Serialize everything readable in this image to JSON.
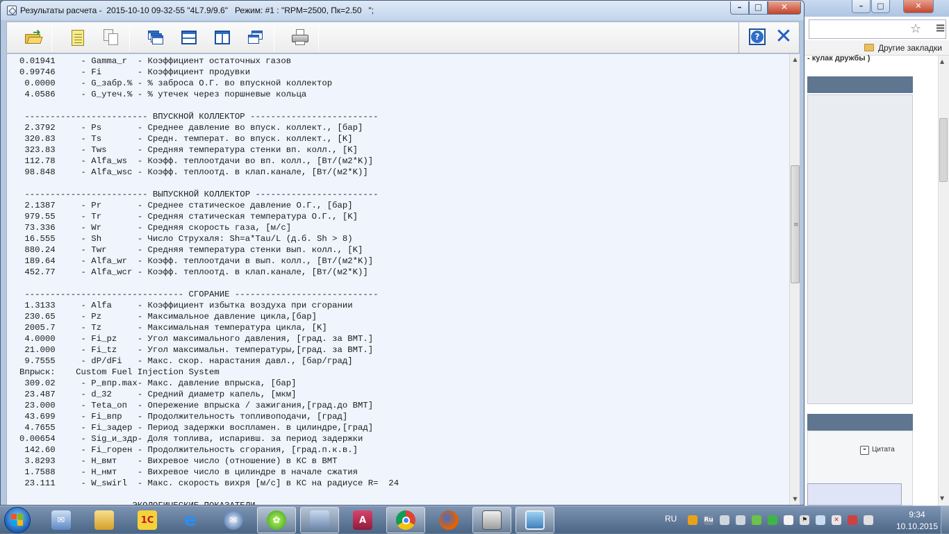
{
  "window": {
    "title": "Результаты расчета -  2015-10-10 09-32-55 \"4L7.9/9.6\"   Режим: #1 : \"RPM=2500, Пк=2.50   \";",
    "min_label": "–",
    "max_label": "□",
    "close_label": "✕"
  },
  "toolbar": {
    "items": [
      "open-icon",
      "new-document-icon",
      "copy-icon",
      "cascade-windows-icon",
      "tile-horizontal-icon",
      "tile-vertical-icon",
      "arrange-windows-icon",
      "print-icon"
    ],
    "help_label": "?",
    "close_label": "✕"
  },
  "results": {
    "lines": [
      "0.01941     - Gamma_r  - Коэффициент остаточных газов",
      "0.99746     - Fi       - Коэффициент продувки",
      " 0.0000     - G_забр.% - % заброса О.Г. во впускной коллектор",
      " 4.0586     - G_утеч.% - % утечек через поршневые кольца",
      "",
      " ------------------------ ВПУСКНОЙ КОЛЛЕКТОР -------------------------",
      " 2.3792     - Ps       - Среднее давление во впуск. коллект., [бар]",
      " 320.83     - Ts       - Средн. температ. во впуск. коллект., [K]",
      " 323.83     - Tws      - Средняя температура стенки вп. колл., [K]",
      " 112.78     - Alfa_ws  - Коэфф. теплоотдачи во вп. колл., [Вт/(м2*K)]",
      " 98.848     - Alfa_wsc - Коэфф. теплоотд. в клап.канале, [Вт/(м2*K)]",
      "",
      " ------------------------ ВЫПУСКНОЙ КОЛЛЕКТОР ------------------------",
      " 2.1387     - Pr       - Среднее статическое давление О.Г., [бар]",
      " 979.55     - Tr       - Средняя статическая температура О.Г., [K]",
      " 73.336     - Wr       - Средняя скорость газа, [м/с]",
      " 16.555     - Sh       - Число Струхаля: Sh=a*Tau/L (д.б. Sh > 8)",
      " 880.24     - Twr      - Средняя температура стенки вып. колл., [K]",
      " 189.64     - Alfa_wr  - Коэфф. теплоотдачи в вып. колл., [Вт/(м2*K)]",
      " 452.77     - Alfa_wcr - Коэфф. теплоотд. в клап.канале, [Вт/(м2*K)]",
      "",
      " ------------------------------- СГОРАНИЕ ----------------------------",
      " 1.3133     - Alfa     - Коэффициент избытка воздуха при сгорании",
      " 230.65     - Pz       - Максимальное давление цикла,[бар]",
      " 2005.7     - Tz       - Максимальная температура цикла, [K]",
      " 4.0000     - Fi_pz    - Угол максимального давления, [град. за ВМТ.]",
      " 21.000     - Fi_tz    - Угол максимальн. температуры,[град. за ВМТ.]",
      " 9.7555     - dP/dFi   - Макс. скор. нарастания давл., [бар/град]",
      "Впрыск:    Custom Fuel Injection System",
      " 309.02     - P_впр.max- Макс. давление впрыска, [бар]",
      " 23.487     - d_32     - Средний диаметр капель, [мкм]",
      " 23.000     - Teta_оп  - Опережение впрыска / зажигания,[град.до ВМТ]",
      " 43.699     - Fi_впр   - Продолжительность топливоподачи, [град]",
      " 4.7655     - Fi_задер - Период задержки воспламен. в цилиндре,[град]",
      "0.00654     - Sig_и_здр- Доля топлива, испаривш. за период задержки",
      " 142.60     - Fi_горен - Продолжительность сгорания, [град.п.к.в.]",
      " 3.8293     - H_вмт    - Вихревое число (отношение) в КС в ВМТ",
      " 1.7588     - H_нмт    - Вихревое число в цилиндре в начале сжатия",
      " 23.111     - W_swirl  - Макс. скорость вихря [м/с] в КС на радиусе R=  24",
      "",
      " -------------------- ЭКОЛОГИЧЕСКИЕ ПОКАЗАТЕЛИ -----------------------"
    ]
  },
  "browser": {
    "bookmarks_label": "Другие закладки",
    "fragment_text": "- кулак дружбы )",
    "quote_label": "Цитата"
  },
  "taskbar": {
    "apps": [
      "mail-icon",
      "file-explorer-icon",
      "1c-icon",
      "internet-explorer-icon",
      "thunderbird-icon",
      "icq-icon",
      "display-settings-icon",
      "access-icon",
      "chrome-icon",
      "firefox-icon",
      "engine-app-icon",
      "image-viewer-icon"
    ],
    "language": "RU",
    "time": "9:34",
    "date": "10.10.2015"
  }
}
